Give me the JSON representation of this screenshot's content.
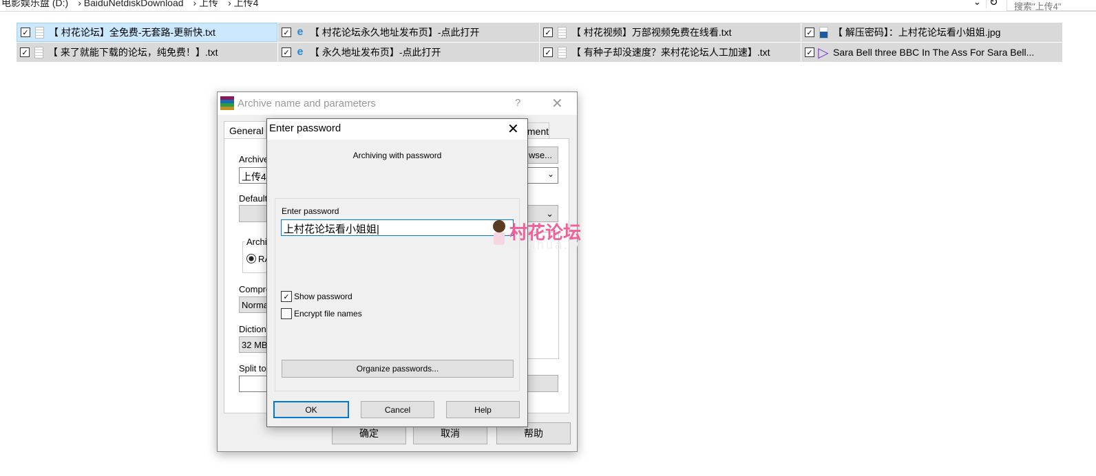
{
  "explorer": {
    "breadcrumb": [
      "电影娱乐盘 (D:)",
      "BaiduNetdiskDownload",
      "上传",
      "上传4"
    ],
    "search_placeholder": "搜索\"上传4\"",
    "files": [
      {
        "name": "【 村花论坛】全免费-无套路-更新快.txt",
        "icon": "text-file-icon",
        "checked": true,
        "selected": true
      },
      {
        "name": "【 村花论坛永久地址发布页】-点此打开",
        "icon": "internet-shortcut-icon",
        "checked": true
      },
      {
        "name": "【 村花视频】万部视频免费在线看.txt",
        "icon": "text-file-icon",
        "checked": true
      },
      {
        "name": "【 解压密码】：上村花论坛看小姐姐.jpg",
        "icon": "image-file-icon",
        "checked": true
      },
      {
        "name": "【 来了就能下载的论坛，纯免费！】.txt",
        "icon": "text-file-icon",
        "checked": true
      },
      {
        "name": "【 永久地址发布页】-点此打开",
        "icon": "internet-shortcut-icon",
        "checked": true
      },
      {
        "name": "【 有种子却没速度？来村花论坛人工加速】.txt",
        "icon": "text-file-icon",
        "checked": true
      },
      {
        "name": "Sara Bell three BBC In The Ass For Sara Bell...",
        "icon": "video-file-icon",
        "checked": true
      }
    ]
  },
  "archive_dialog": {
    "title": "Archive name and parameters",
    "help": "?",
    "tabs": [
      "General",
      "ment"
    ],
    "archive_name_label": "Archive",
    "archive_name_value": "上传4",
    "browse": "wse...",
    "default_profile_label": "Default",
    "format_group": "Archiv",
    "format_radio": "RA",
    "compression_label": "Compre",
    "compression_value": "Norma",
    "dictionary_label": "Dictiona",
    "dictionary_value": "32 MB",
    "split_label": "Split to",
    "ok": "确定",
    "cancel": "取消",
    "help_btn": "帮助"
  },
  "password_dialog": {
    "title": "Enter password",
    "subtitle": "Archiving with password",
    "field_label": "Enter password",
    "password_value": "上村花论坛看小姐姐",
    "show_password": {
      "label": "Show password",
      "checked": true
    },
    "encrypt_names": {
      "label": "Encrypt file names",
      "checked": false
    },
    "organize": "Organize passwords...",
    "ok": "OK",
    "cancel": "Cancel",
    "help": "Help"
  },
  "watermark": {
    "text": "村花论坛",
    "sub": "cunhua.wi",
    "color": "#f2609a"
  }
}
